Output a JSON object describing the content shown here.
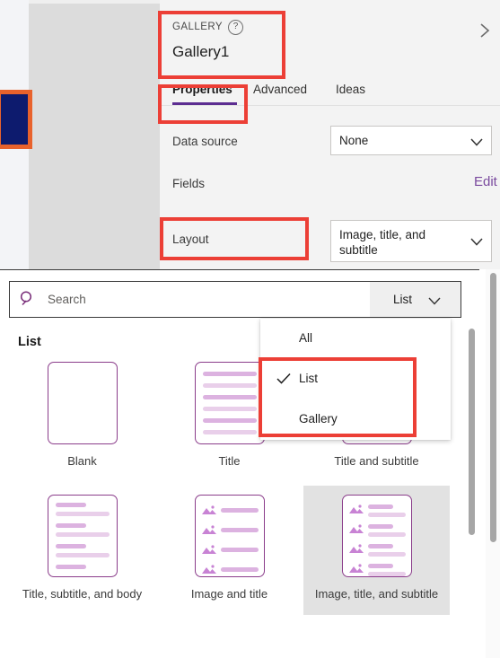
{
  "panel": {
    "kicker": "GALLERY",
    "help_icon": "question-mark-icon",
    "title": "Gallery1",
    "collapse_icon": "chevron-right-icon",
    "tabs": [
      {
        "label": "Properties",
        "active": true
      },
      {
        "label": "Advanced",
        "active": false
      },
      {
        "label": "Ideas",
        "active": false
      }
    ],
    "rows": {
      "data_source_label": "Data source",
      "data_source_value": "None",
      "fields_label": "Fields",
      "fields_action": "Edit",
      "layout_label": "Layout",
      "layout_value": "Image, title, and subtitle"
    },
    "accent_color": "#5c2d91",
    "link_color": "#7a4a9e"
  },
  "dialog": {
    "search": {
      "icon": "search-icon",
      "placeholder": "Search",
      "value": ""
    },
    "filter": {
      "label": "List",
      "icon": "chevron-down-icon"
    },
    "group_title": "List",
    "cards": [
      {
        "caption": "Blank",
        "selected": false,
        "thumb": "blank"
      },
      {
        "caption": "Title",
        "selected": false,
        "thumb": "title"
      },
      {
        "caption": "Title and subtitle",
        "selected": false,
        "thumb": "title-subtitle"
      },
      {
        "caption": "Title, subtitle, and body",
        "selected": false,
        "thumb": "title-subtitle-body"
      },
      {
        "caption": "Image and title",
        "selected": false,
        "thumb": "image-title"
      },
      {
        "caption": "Image, title, and subtitle",
        "selected": true,
        "thumb": "image-title-subtitle"
      }
    ]
  },
  "menu": {
    "items": [
      {
        "label": "All",
        "checked": false
      },
      {
        "label": "List",
        "checked": true
      },
      {
        "label": "Gallery",
        "checked": false
      }
    ],
    "check_icon": "checkmark-icon"
  },
  "canvas": {
    "selected_control_fill": "#0d1b6e",
    "selected_control_border": "#e8622c"
  },
  "annotations": {
    "color": "#ec3f36",
    "boxes": [
      "gallery-title",
      "properties-tab",
      "layout-row",
      "menu-list-gallery"
    ]
  }
}
